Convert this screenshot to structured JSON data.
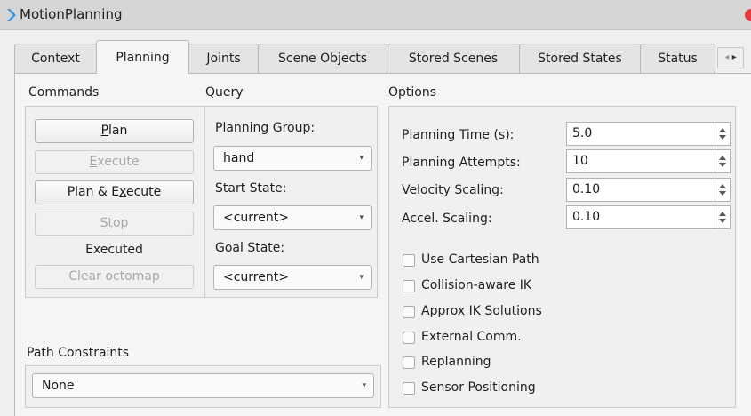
{
  "window": {
    "title": "MotionPlanning"
  },
  "tabs": [
    {
      "label": "Context"
    },
    {
      "label": "Planning"
    },
    {
      "label": "Joints"
    },
    {
      "label": "Scene Objects"
    },
    {
      "label": "Stored Scenes"
    },
    {
      "label": "Stored States"
    },
    {
      "label": "Status"
    }
  ],
  "tab_scroll": {
    "left": "◂",
    "right": "▸"
  },
  "commands": {
    "header": "Commands",
    "plan": {
      "pre": "",
      "key": "P",
      "post": "lan"
    },
    "execute": {
      "pre": "",
      "key": "E",
      "post": "xecute"
    },
    "plan_execute": {
      "pre": "Plan & E",
      "key": "x",
      "post": "ecute"
    },
    "stop": {
      "pre": "",
      "key": "S",
      "post": "top"
    },
    "status": "Executed",
    "clear_octomap": "Clear octomap"
  },
  "query": {
    "header": "Query",
    "planning_group_label": "Planning Group:",
    "planning_group_value": "hand",
    "start_state_label": "Start State:",
    "start_state_value": "<current>",
    "goal_state_label": "Goal State:",
    "goal_state_value": "<current>"
  },
  "options": {
    "header": "Options",
    "planning_time_label": "Planning Time (s):",
    "planning_time_value": "5.0",
    "planning_attempts_label": "Planning Attempts:",
    "planning_attempts_value": "10",
    "velocity_scaling_label": "Velocity Scaling:",
    "velocity_scaling_value": "0.10",
    "accel_scaling_label": "Accel. Scaling:",
    "accel_scaling_value": "0.10",
    "checkboxes": [
      {
        "label": "Use Cartesian Path",
        "checked": false
      },
      {
        "label": "Collision-aware IK",
        "checked": false
      },
      {
        "label": "Approx IK Solutions",
        "checked": false
      },
      {
        "label": "External Comm.",
        "checked": false
      },
      {
        "label": "Replanning",
        "checked": false
      },
      {
        "label": "Sensor Positioning",
        "checked": false
      }
    ]
  },
  "path_constraints": {
    "header": "Path Constraints",
    "value": "None"
  },
  "icons": {
    "dropdown": "▾"
  },
  "colors": {
    "title_icon": "#3a8fd6",
    "close_button": "#e53b3b",
    "disabled_text": "#a8a8a8"
  }
}
